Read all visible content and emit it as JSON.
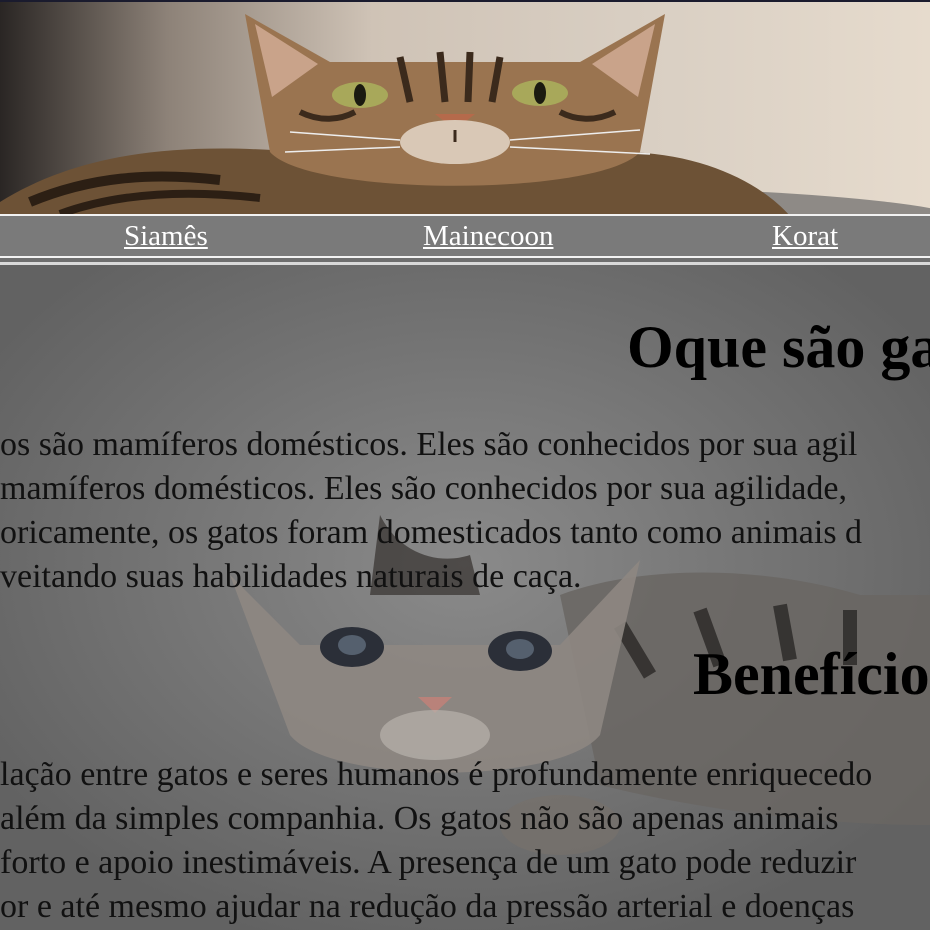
{
  "header": {
    "image_alt": "Gato tigrado deitado"
  },
  "nav": {
    "links": [
      {
        "label": "Siamês"
      },
      {
        "label": "Mainecoon"
      },
      {
        "label": "Korat"
      }
    ]
  },
  "main": {
    "title": "Oque são ga",
    "intro_lines": [
      "os são mamíferos domésticos. Eles são conhecidos por sua agil",
      "mamíferos domésticos. Eles são conhecidos por sua agilidade,",
      "oricamente, os gatos foram domesticados tanto como animais d",
      "veitando suas habilidades naturais de caça."
    ],
    "benefits_title": "Benefício",
    "benefits_lines": [
      "lação entre gatos e seres humanos é profundamente enriquecedo",
      "além da simples companhia. Os gatos não são apenas animais",
      "forto e apoio inestimáveis. A presença de um gato pode reduzir",
      "or e até mesmo ajudar na redução da pressão arterial e doenças"
    ]
  },
  "colors": {
    "page_background": "#6e6e6e",
    "navbar_background": "#7a7a7a",
    "nav_link": "#ffffff",
    "text": "#000000"
  }
}
